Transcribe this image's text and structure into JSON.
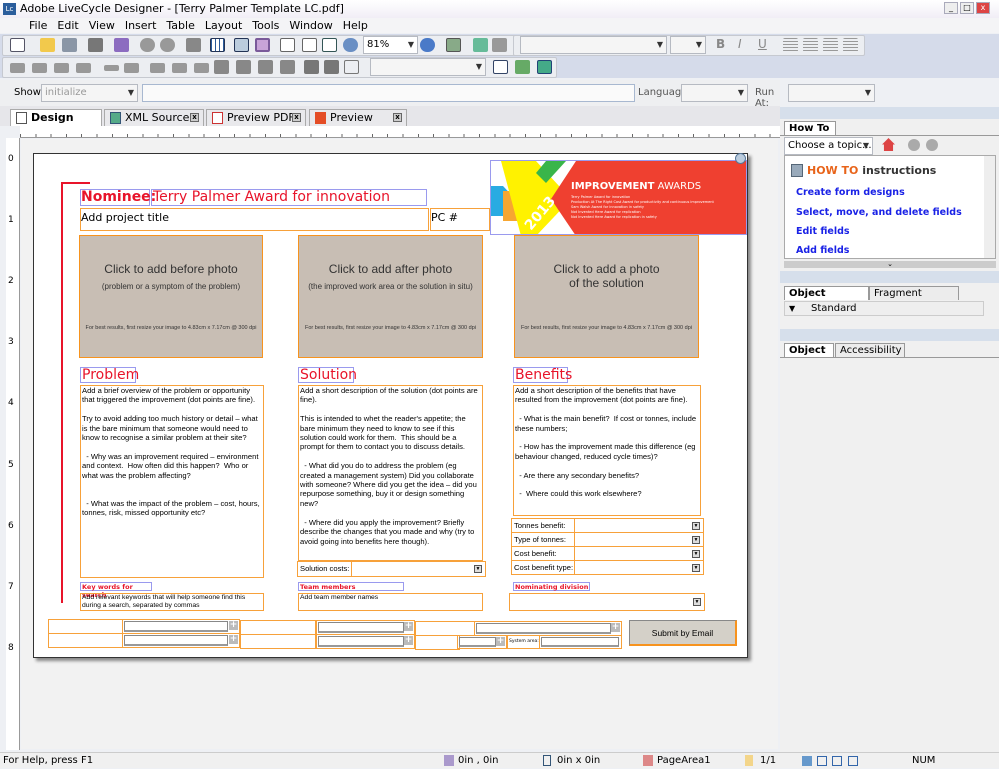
{
  "window": {
    "title": "Adobe LiveCycle Designer - [Terry Palmer Template LC.pdf]",
    "logo": "Lc"
  },
  "menu": [
    "File",
    "Edit",
    "View",
    "Insert",
    "Table",
    "Layout",
    "Tools",
    "Window",
    "Help"
  ],
  "toolbar": {
    "zoom": "81%",
    "bold": "B",
    "italic": "I",
    "underline": "U"
  },
  "scriptbar": {
    "show_label": "Show:",
    "show_value": "initialize",
    "language_label": "Language:",
    "run_at_label": "Run At:"
  },
  "tabs": [
    {
      "label": "Design View",
      "active": true
    },
    {
      "label": "XML Source"
    },
    {
      "label": "Preview PDF"
    },
    {
      "label": "Preview HTML"
    }
  ],
  "ruler": {
    "vertical": [
      "0",
      "1",
      "2",
      "3",
      "4",
      "5",
      "6",
      "7",
      "8"
    ]
  },
  "form": {
    "nominee_label": "Nominee:",
    "nominee_value": "Terry Palmer Award for innovation",
    "project_title": "Add project title",
    "pc_label": "PC #",
    "banner": {
      "year": "2013",
      "title_bold": "IMPROVEMENT",
      "title_light": " AWARDS",
      "items": [
        "Terry Palmer Award for innovation",
        "Production At The Right Cost Award for productivity and continuous improvement",
        "Sam Walsh Award for innovation in safety",
        "Not Invented Here Award for replication",
        "Not Invented Here Award for replication in safety"
      ]
    },
    "photos": [
      {
        "title": "Click to add before photo",
        "subtitle": "(problem or a symptom of the problem)",
        "hint": "For best results, first resize your image to 4.83cm x 7.17cm @ 300 dpi"
      },
      {
        "title": "Click to add after photo",
        "subtitle": "(the improved work area or the solution in situ)",
        "hint": "For best results, first resize your image to 4.83cm x 7.17cm @ 300 dpi"
      },
      {
        "title": "Click to add a photo\nof the solution",
        "subtitle": "",
        "hint": "For best results, first resize your image to 4.83cm x 7.17cm @ 300 dpi"
      }
    ],
    "problem": {
      "heading": "Problem",
      "text": "Add a brief overview of the problem or opportunity that triggered the improvement (dot points are fine).\n\nTry to avoid adding too much history or detail – what is the bare minimum that someone would need to know to recognise a similar problem at their site?\n\n  - Why was an improvement required – environment and context.  How often did this happen?  Who or what was the problem affecting?\n\n\n  - What was the impact of the problem – cost, hours, tonnes, risk, missed opportunity etc?"
    },
    "solution": {
      "heading": "Solution",
      "text": "Add a short description of the solution (dot points are fine).\n\nThis is intended to whet the reader's appetite; the bare minimum they need to know to see if this solution could work for them.  This should be a prompt for them to contact you to discuss details.\n\n  - What did you do to address the problem (eg created a management system) Did you collaborate with someone? Where did you get the idea – did you repurpose something, buy it or design something new?\n\n  - Where did you apply the improvement? Briefly describe the changes that you made and why (try to avoid going into benefits here though).",
      "costs_label": "Solution costs:"
    },
    "benefits": {
      "heading": "Benefits",
      "text": "Add a short description of the benefits that have resulted from the improvement (dot points are fine).\n\n  - What is the main benefit?  If cost or tonnes, include these numbers;\n\n  - How has the improvement made this difference (eg behaviour changed, reduced cycle times)?\n\n  - Are there any secondary benefits?\n\n  -  Where could this work elsewhere?",
      "rows": [
        "Tonnes benefit:",
        "Type of tonnes:",
        "Cost benefit:",
        "Cost benefit type:"
      ]
    },
    "keywords": {
      "label": "Key words for search",
      "text": "Add relevant keywords that will help someone find this during a search, separated by commas"
    },
    "team": {
      "label": "Team members",
      "text": "Add team member names"
    },
    "division": {
      "label": "Nominating division"
    },
    "system_area_label": "System area:",
    "submit": "Submit by Email"
  },
  "right_panel": {
    "howto_tab": "How To",
    "topic": "Choose a topic...",
    "howto_title_a": "HOW TO",
    "howto_title_b": " instructions",
    "links": [
      "Create form designs",
      "Select, move, and delete fields",
      "Edit fields",
      "Add fields"
    ],
    "library_tabs": [
      "Object Library",
      "Fragment Library"
    ],
    "library_group": "Standard",
    "object_tabs": [
      "Object",
      "Accessibility"
    ]
  },
  "status": {
    "help": "For Help, press F1",
    "position": "0in , 0in",
    "size": "0in x 0in",
    "page_area": "PageArea1",
    "page": "1/1",
    "num": "NUM"
  },
  "colors": {
    "accent_red": "#e8142a",
    "field_orange": "#f7a13a",
    "photo_bg": "#c8beb4",
    "toolbar_bg": "#d5dbea"
  }
}
